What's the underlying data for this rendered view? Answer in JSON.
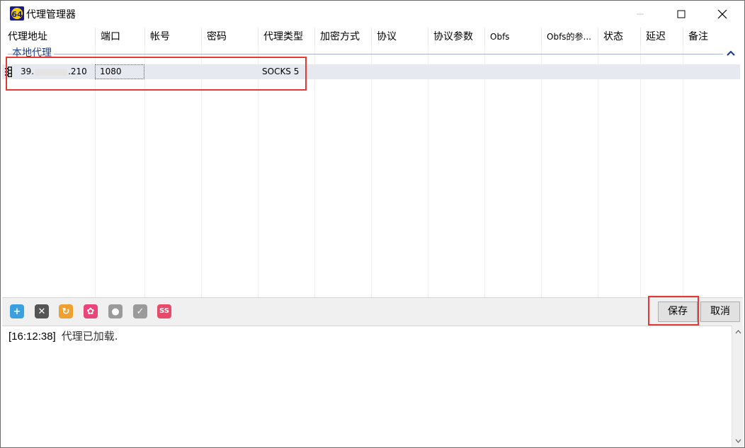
{
  "window": {
    "title": "代理管理器",
    "app_icon_text": "64"
  },
  "columns": [
    {
      "label": "代理地址"
    },
    {
      "label": "端口"
    },
    {
      "label": "帐号"
    },
    {
      "label": "密码"
    },
    {
      "label": "代理类型"
    },
    {
      "label": "加密方式"
    },
    {
      "label": "协议"
    },
    {
      "label": "协议参数"
    },
    {
      "label": "Obfs"
    },
    {
      "label": "Obfs的参..."
    },
    {
      "label": "状态"
    },
    {
      "label": "延迟"
    },
    {
      "label": "备注"
    }
  ],
  "group": {
    "label": "本地代理"
  },
  "rows": [
    {
      "address_prefix": "39.",
      "address_suffix": ".210",
      "port": "1080",
      "account": "",
      "password": "",
      "type": "SOCKS 5",
      "encryption": "",
      "protocol": "",
      "protocol_params": "",
      "obfs": "",
      "obfs_params": "",
      "status": "",
      "latency": "",
      "note": ""
    }
  ],
  "toolbar": {
    "icons": [
      {
        "name": "add-icon",
        "glyph": "+",
        "color": "#3aa0e0"
      },
      {
        "name": "delete-icon",
        "glyph": "✕",
        "color": "#555555"
      },
      {
        "name": "refresh-icon",
        "glyph": "↻",
        "color": "#f0a030"
      },
      {
        "name": "settings-icon",
        "glyph": "✿",
        "color": "#e8457a"
      },
      {
        "name": "lightbulb-icon",
        "glyph": "●",
        "color": "#9a9a9a"
      },
      {
        "name": "check-icon",
        "glyph": "✓",
        "color": "#9a9a9a"
      },
      {
        "name": "ss-icon",
        "glyph": "SS",
        "color": "#e84a6a"
      }
    ],
    "save_label": "保存",
    "cancel_label": "取消"
  },
  "log": {
    "time": "[16:12:38]",
    "message": "代理已加载."
  },
  "colors": {
    "group_text": "#1e3c8c",
    "row_bg": "#e6e9f0",
    "highlight": "#e53935"
  }
}
